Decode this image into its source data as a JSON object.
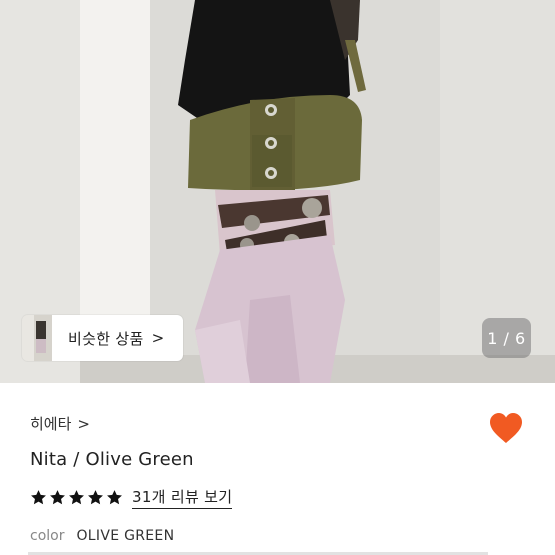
{
  "hero": {
    "similar_products_label": "비슷한 상품",
    "similar_products_chevron": ">",
    "page_counter": "1 / 6"
  },
  "product": {
    "brand": "히에타",
    "brand_chevron": ">",
    "title": "Nita / Olive Green",
    "rating_stars": 5,
    "review_link": "31개 리뷰 보기",
    "option_label": "color",
    "option_value": "OLIVE GREEN"
  },
  "colors": {
    "heart": "#f15a22",
    "star": "#111111"
  },
  "icons": [
    "heart-icon",
    "star-icon",
    "chevron-right-icon"
  ]
}
